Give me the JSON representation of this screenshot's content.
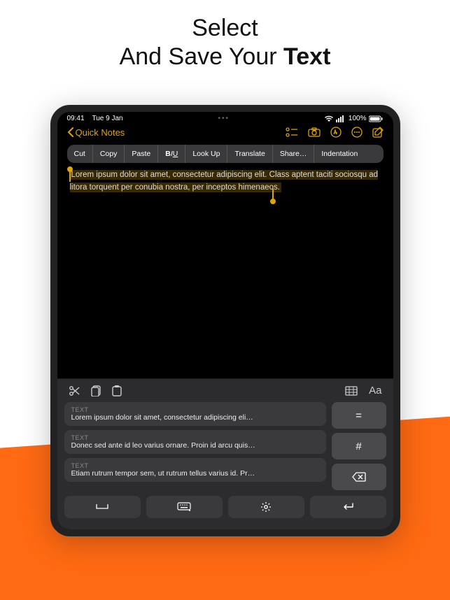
{
  "headline": {
    "line1": "Select",
    "line2_pre": "And Save Your ",
    "line2_bold": "Text"
  },
  "status": {
    "time": "09:41",
    "date": "Tue 9 Jan",
    "battery": "100%"
  },
  "nav": {
    "back": "Quick Notes"
  },
  "context_menu": {
    "cut": "Cut",
    "copy": "Copy",
    "paste": "Paste",
    "lookup": "Look Up",
    "translate": "Translate",
    "share": "Share…",
    "indentation": "Indentation"
  },
  "note_text": "Lorem ipsum dolor sit amet, consectetur adipiscing elit. Class aptent taciti sociosqu ad litora torquent per conubia nostra, per inceptos himenaeos.",
  "clips": [
    {
      "tag": "TEXT",
      "text": "Lorem ipsum dolor sit amet, consectetur adipiscing eli…"
    },
    {
      "tag": "TEXT",
      "text": "Donec sed ante id leo varius ornare. Proin id arcu quis…"
    },
    {
      "tag": "TEXT",
      "text": "Etiam rutrum tempor sem, ut rutrum tellus varius id. Pr…"
    }
  ],
  "keys": {
    "eq": "=",
    "hash": "#"
  },
  "aa": "Aa"
}
